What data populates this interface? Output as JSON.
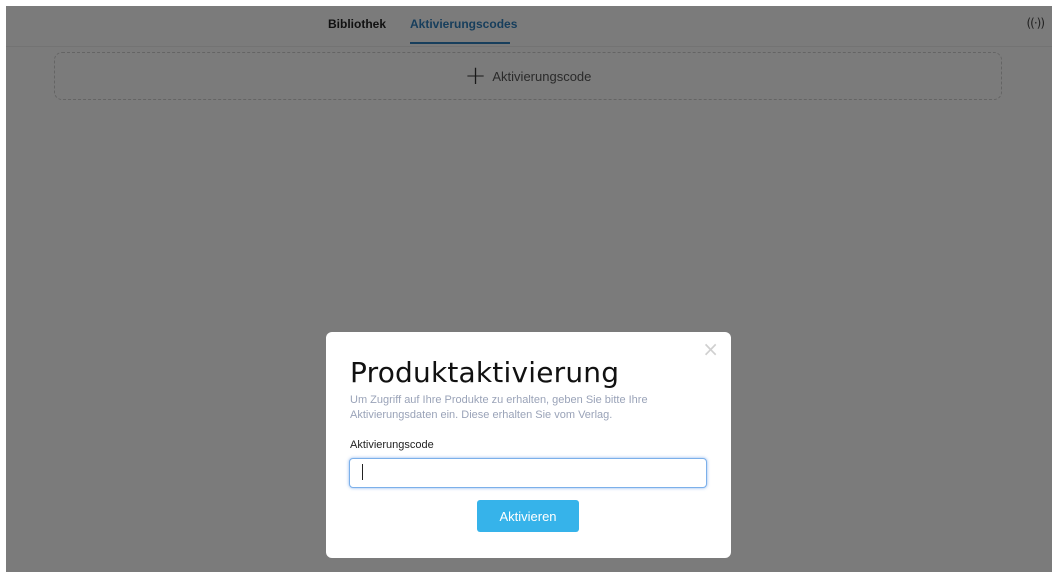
{
  "topbar": {
    "tabs": [
      {
        "label": "Bibliothek",
        "active": false
      },
      {
        "label": "Aktivierungscodes",
        "active": true
      }
    ],
    "status_icon": "((·))"
  },
  "main": {
    "add_button": {
      "icon": "+",
      "label": "Aktivierungscode"
    }
  },
  "modal": {
    "close_icon": "×",
    "title": "Produktaktivierung",
    "description": "Um Zugriff auf Ihre Produkte zu erhalten, geben Sie bitte Ihre Aktivierungsdaten ein. Diese erhalten Sie vom Verlag.",
    "field_label": "Aktivierungscode",
    "field_value": "",
    "field_placeholder": "",
    "submit_label": "Aktivieren"
  },
  "colors": {
    "accent": "#2f7db8",
    "button": "#36b3ea",
    "description_text": "#9aa3b8"
  }
}
